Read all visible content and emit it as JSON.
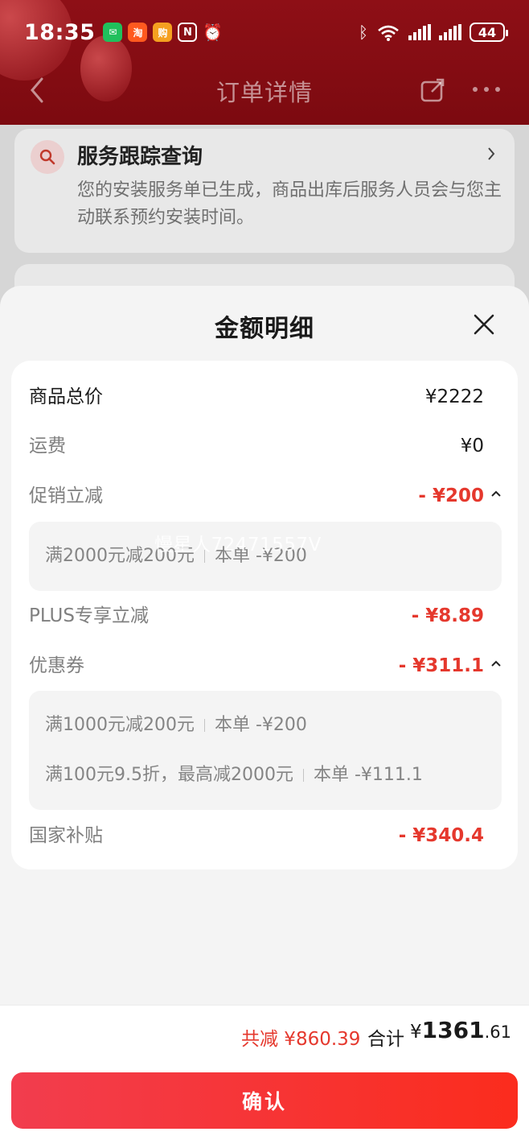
{
  "status_bar": {
    "time": "18:35",
    "battery": "44",
    "network": "6"
  },
  "nav": {
    "title": "订单详情"
  },
  "background_card": {
    "title": "服务跟踪查询",
    "description": "您的安装服务单已生成，商品出库后服务人员会与您主动联系预约安装时间。"
  },
  "sheet": {
    "title": "金额明细",
    "watermark": "慢星人72471557V",
    "rows": {
      "goods_total": {
        "label": "商品总价",
        "value": "¥2222"
      },
      "shipping": {
        "label": "运费",
        "value": "¥0"
      },
      "promo": {
        "label": "促销立减",
        "value": "- ¥200"
      },
      "plus": {
        "label": "PLUS专享立减",
        "value": "- ¥8.89"
      },
      "coupon": {
        "label": "优惠券",
        "value": "- ¥311.1"
      },
      "subsidy": {
        "label": "国家补贴",
        "value": "- ¥340.4"
      }
    },
    "promo_details": [
      {
        "rule": "满2000元减200元",
        "amount": "本单 -¥200"
      }
    ],
    "coupon_details": [
      {
        "rule": "满1000元减200元",
        "amount": "本单 -¥200"
      },
      {
        "rule": "满100元9.5折，最高减2000元",
        "amount": "本单 -¥111.1"
      }
    ]
  },
  "footer": {
    "discount_total": "共减 ¥860.39",
    "total_label": "合计",
    "total_yen": "¥",
    "total_int": "1361",
    "total_dec": ".61",
    "confirm_label": "确认"
  },
  "colors": {
    "accent_red": "#e5382d",
    "header_red": "#8e0f16",
    "button_red": "#f23d4e"
  }
}
